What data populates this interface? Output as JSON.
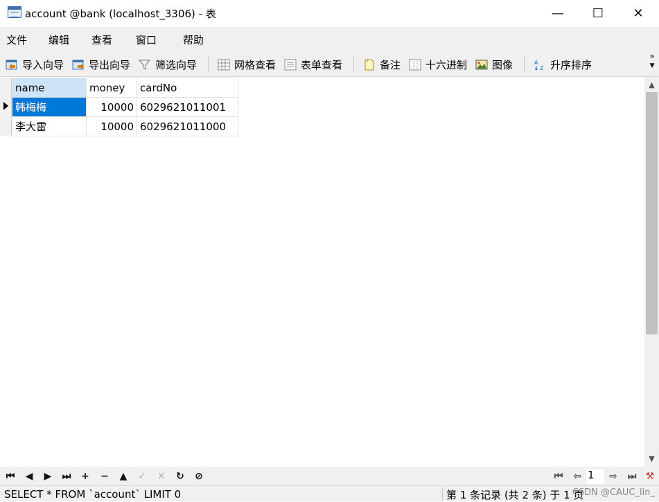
{
  "window": {
    "title": "account @bank (localhost_3306) - 表",
    "minimize": "—",
    "maximize": "☐",
    "close": "✕"
  },
  "menu": [
    "文件",
    "编辑",
    "查看",
    "窗口",
    "帮助"
  ],
  "toolbar": {
    "import": "导入向导",
    "export": "导出向导",
    "filter": "筛选向导",
    "grid_view": "网格查看",
    "form_view": "表单查看",
    "memo": "备注",
    "hex": "十六进制",
    "image": "图像",
    "sort_asc": "升序排序",
    "more": "»"
  },
  "table": {
    "columns": [
      "name",
      "money",
      "cardNo"
    ],
    "rows": [
      [
        "韩梅梅",
        "10000",
        "6029621011001"
      ],
      [
        "李大雷",
        "10000",
        "6029621011000"
      ]
    ]
  },
  "nav": {
    "first": "⏮",
    "prev": "◀",
    "next": "▶",
    "last": "⏭",
    "add": "+",
    "delete": "−",
    "up": "▲",
    "apply": "✓",
    "discard": "✕",
    "refresh": "↻",
    "stop": "⊘",
    "page_first": "⏮",
    "page_prev": "⇦",
    "page": "1",
    "page_next": "⇨",
    "page_last": "⏭",
    "settings": "⚒"
  },
  "status": {
    "sql": "SELECT * FROM `account` LIMIT 0",
    "records": "第 1 条记录 (共 2 条) 于 1 页",
    "watermark": "CSDN @CAUC_lin_"
  }
}
